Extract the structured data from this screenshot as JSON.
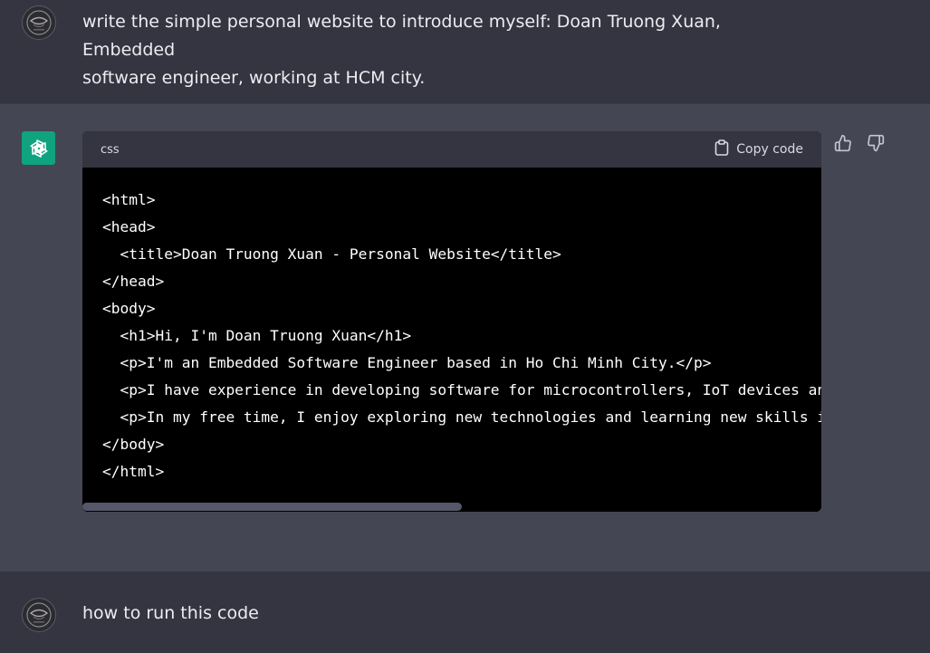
{
  "conversation": {
    "user_message_1": {
      "line1": "write the simple personal website to introduce myself: Doan Truong Xuan, Embedded",
      "line2": "software engineer, working at HCM city."
    },
    "assistant_message": {
      "code_block": {
        "language": "css",
        "copy_label": "Copy code",
        "lines": [
          "<html>",
          "<head>",
          "  <title>Doan Truong Xuan - Personal Website</title>",
          "</head>",
          "<body>",
          "  <h1>Hi, I'm Doan Truong Xuan</h1>",
          "  <p>I'm an Embedded Software Engineer based in Ho Chi Minh City.</p>",
          "  <p>I have experience in developing software for microcontrollers, IoT devices and",
          "  <p>In my free time, I enjoy exploring new technologies and learning new skills ir",
          "</body>",
          "</html>"
        ]
      }
    },
    "user_message_2": {
      "text": "how to run this code"
    }
  },
  "icons": {
    "gpt_logo": "openai-logo-icon",
    "copy": "clipboard-icon",
    "thumbs_up": "thumbs-up-icon",
    "thumbs_down": "thumbs-down-icon"
  },
  "colors": {
    "page_bg": "#343541",
    "assistant_bg": "#444654",
    "gpt_accent": "#10a37f",
    "code_bg": "#000000"
  }
}
